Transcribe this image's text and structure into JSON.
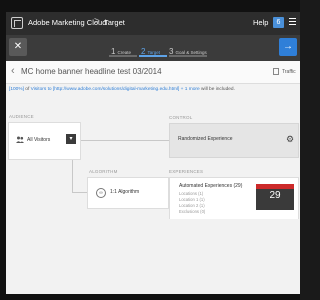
{
  "colors": {
    "accent": "#2f7fd8",
    "topbar": "#2d2d2d",
    "stepbar": "#3b3b3b"
  },
  "topbar": {
    "app_name": "Adobe Marketing Cloud",
    "separator": ">",
    "section": "Target",
    "help": "Help",
    "badge": "6"
  },
  "steps": [
    {
      "num": "1",
      "label": "Create",
      "active": false
    },
    {
      "num": "2",
      "label": "Target",
      "active": true
    },
    {
      "num": "3",
      "label": "Goal & Settings",
      "active": false
    }
  ],
  "stepbar": {
    "close": "✕",
    "next": "→"
  },
  "activity": {
    "back": "‹",
    "title": "MC home banner headline test 03/2014",
    "traffic_label": "Traffic"
  },
  "info": {
    "percent": "[100%]",
    "of": " of ",
    "visitors_link": "Visitors to [http://www.adobe.com/solutions/digital-marketing.edu.html] + 1 more",
    "suffix": " will be included."
  },
  "headers": {
    "audience": "AUDIENCE",
    "control": "CONTROL",
    "algorithm": "ALGORITHM",
    "experiences": "EXPERIENCES"
  },
  "audience": {
    "label": "All Visitors",
    "dropdown": "▾"
  },
  "control": {
    "label": "Randomized Experience"
  },
  "algorithm": {
    "label": "1:1 Algorithm"
  },
  "experiences": {
    "title": "Automated Experiences (29)",
    "locations": "Locations (1)",
    "location1": "Location 1 (1)",
    "location2": "Location 2 (1)",
    "exclusions": "Exclusions (0)",
    "thumb_count": "29"
  }
}
